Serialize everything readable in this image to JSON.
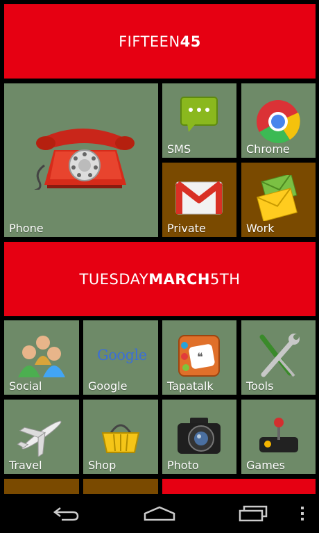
{
  "clock_banner": {
    "part1": "FIFTEEN",
    "part2": "45"
  },
  "date_banner": {
    "part1": "TUESDAY",
    "part2": "MARCH",
    "part3": "5TH"
  },
  "tiles": {
    "phone": "Phone",
    "sms": "SMS",
    "chrome": "Chrome",
    "private": "Private",
    "work": "Work",
    "social": "Social",
    "google": "Google",
    "tapatalk": "Tapatalk",
    "tools": "Tools",
    "travel": "Travel",
    "shop": "Shop",
    "photo": "Photo",
    "games": "Games"
  },
  "google_logo": "Google",
  "colors": {
    "tile_green": "#6e8a68",
    "tile_brown": "#7a4a00",
    "accent_red": "#e60012"
  },
  "icons": [
    "telephone-icon",
    "sms-bubble-icon",
    "chrome-icon",
    "gmail-icon",
    "mail-envelope-icon",
    "people-icon",
    "google-logo-icon",
    "tapatalk-icon",
    "wrench-screwdriver-icon",
    "airplane-icon",
    "shopping-basket-icon",
    "camera-icon",
    "joystick-icon",
    "back-icon",
    "home-icon",
    "recents-icon",
    "overflow-menu-icon"
  ]
}
